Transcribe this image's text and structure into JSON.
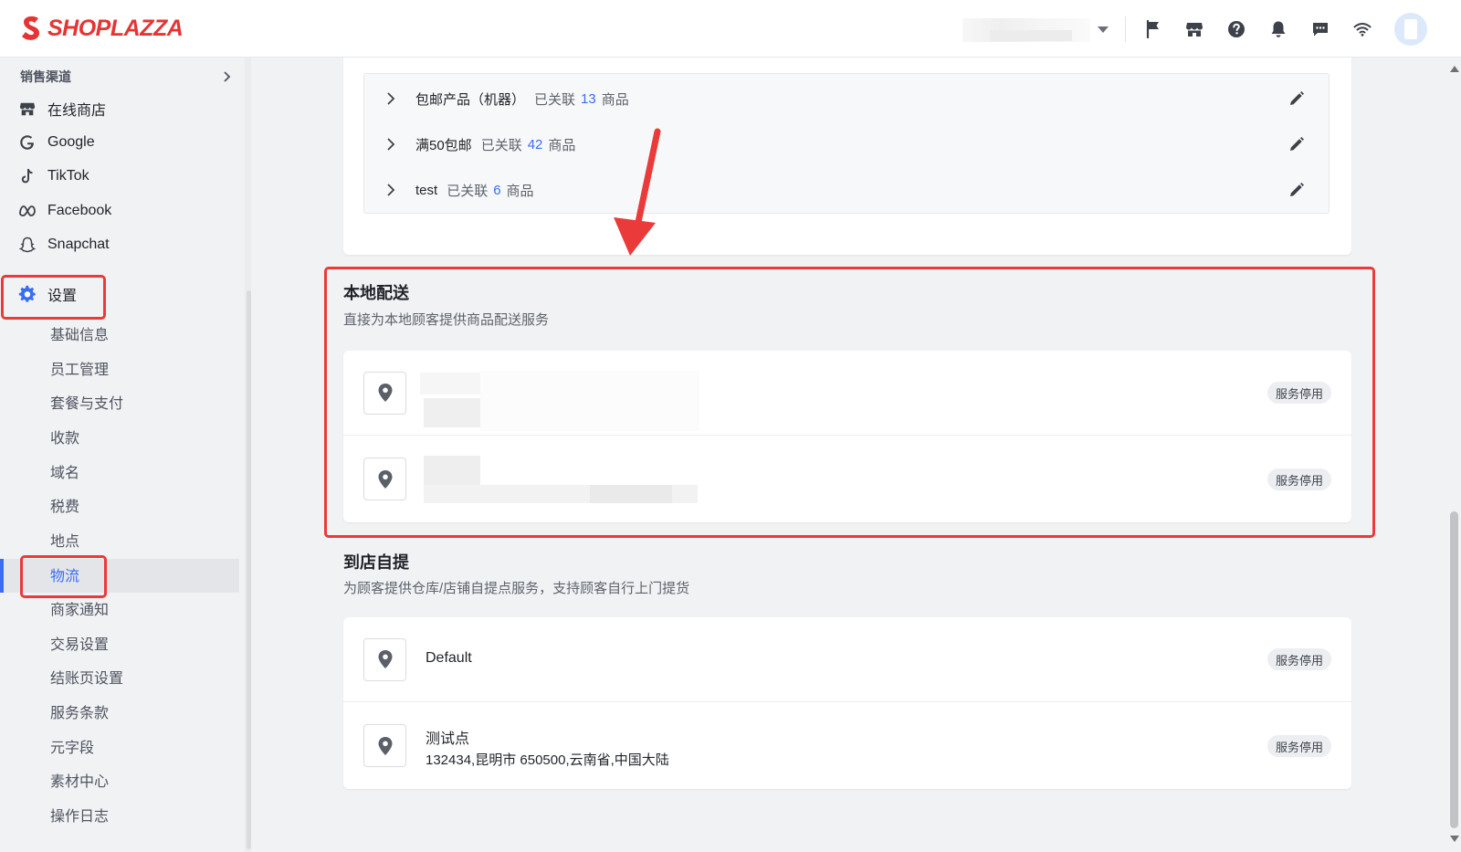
{
  "brand": {
    "logo_text": "SHOPLAZZA",
    "accent": "#e53434",
    "link_color": "#3a6df0"
  },
  "topbar": {
    "icons": [
      "flag-icon",
      "store-icon",
      "help-icon",
      "bell-icon",
      "message-icon",
      "wifi-icon"
    ]
  },
  "sidebar": {
    "section_label": "销售渠道",
    "channels": [
      {
        "label": "在线商店",
        "icon": "store-icon"
      },
      {
        "label": "Google",
        "icon": "google-icon"
      },
      {
        "label": "TikTok",
        "icon": "tiktok-icon"
      },
      {
        "label": "Facebook",
        "icon": "meta-icon"
      },
      {
        "label": "Snapchat",
        "icon": "snapchat-icon"
      }
    ],
    "settings_label": "设置",
    "settings_items": [
      "基础信息",
      "员工管理",
      "套餐与支付",
      "收款",
      "域名",
      "税费",
      "地点",
      "物流",
      "商家通知",
      "交易设置",
      "结账页设置",
      "服务条款",
      "元字段",
      "素材中心",
      "操作日志"
    ],
    "active_item": "物流"
  },
  "shipping_zones": [
    {
      "name": "包邮产品（机器）",
      "prefix": "已关联",
      "count": "13",
      "suffix": "商品"
    },
    {
      "name": "满50包邮",
      "prefix": "已关联",
      "count": "42",
      "suffix": "商品"
    },
    {
      "name": "test",
      "prefix": "已关联",
      "count": "6",
      "suffix": "商品"
    }
  ],
  "local_delivery": {
    "title": "本地配送",
    "description": "直接为本地顾客提供商品配送服务",
    "locations": [
      {
        "status": "服务停用"
      },
      {
        "status": "服务停用"
      }
    ]
  },
  "pickup": {
    "title": "到店自提",
    "description": "为顾客提供仓库/店铺自提点服务，支持顾客自行上门提货",
    "locations": [
      {
        "name": "Default",
        "address": "",
        "status": "服务停用"
      },
      {
        "name": "测试点",
        "address": "132434,昆明市 650500,云南省,中国大陆",
        "status": "服务停用"
      }
    ]
  }
}
